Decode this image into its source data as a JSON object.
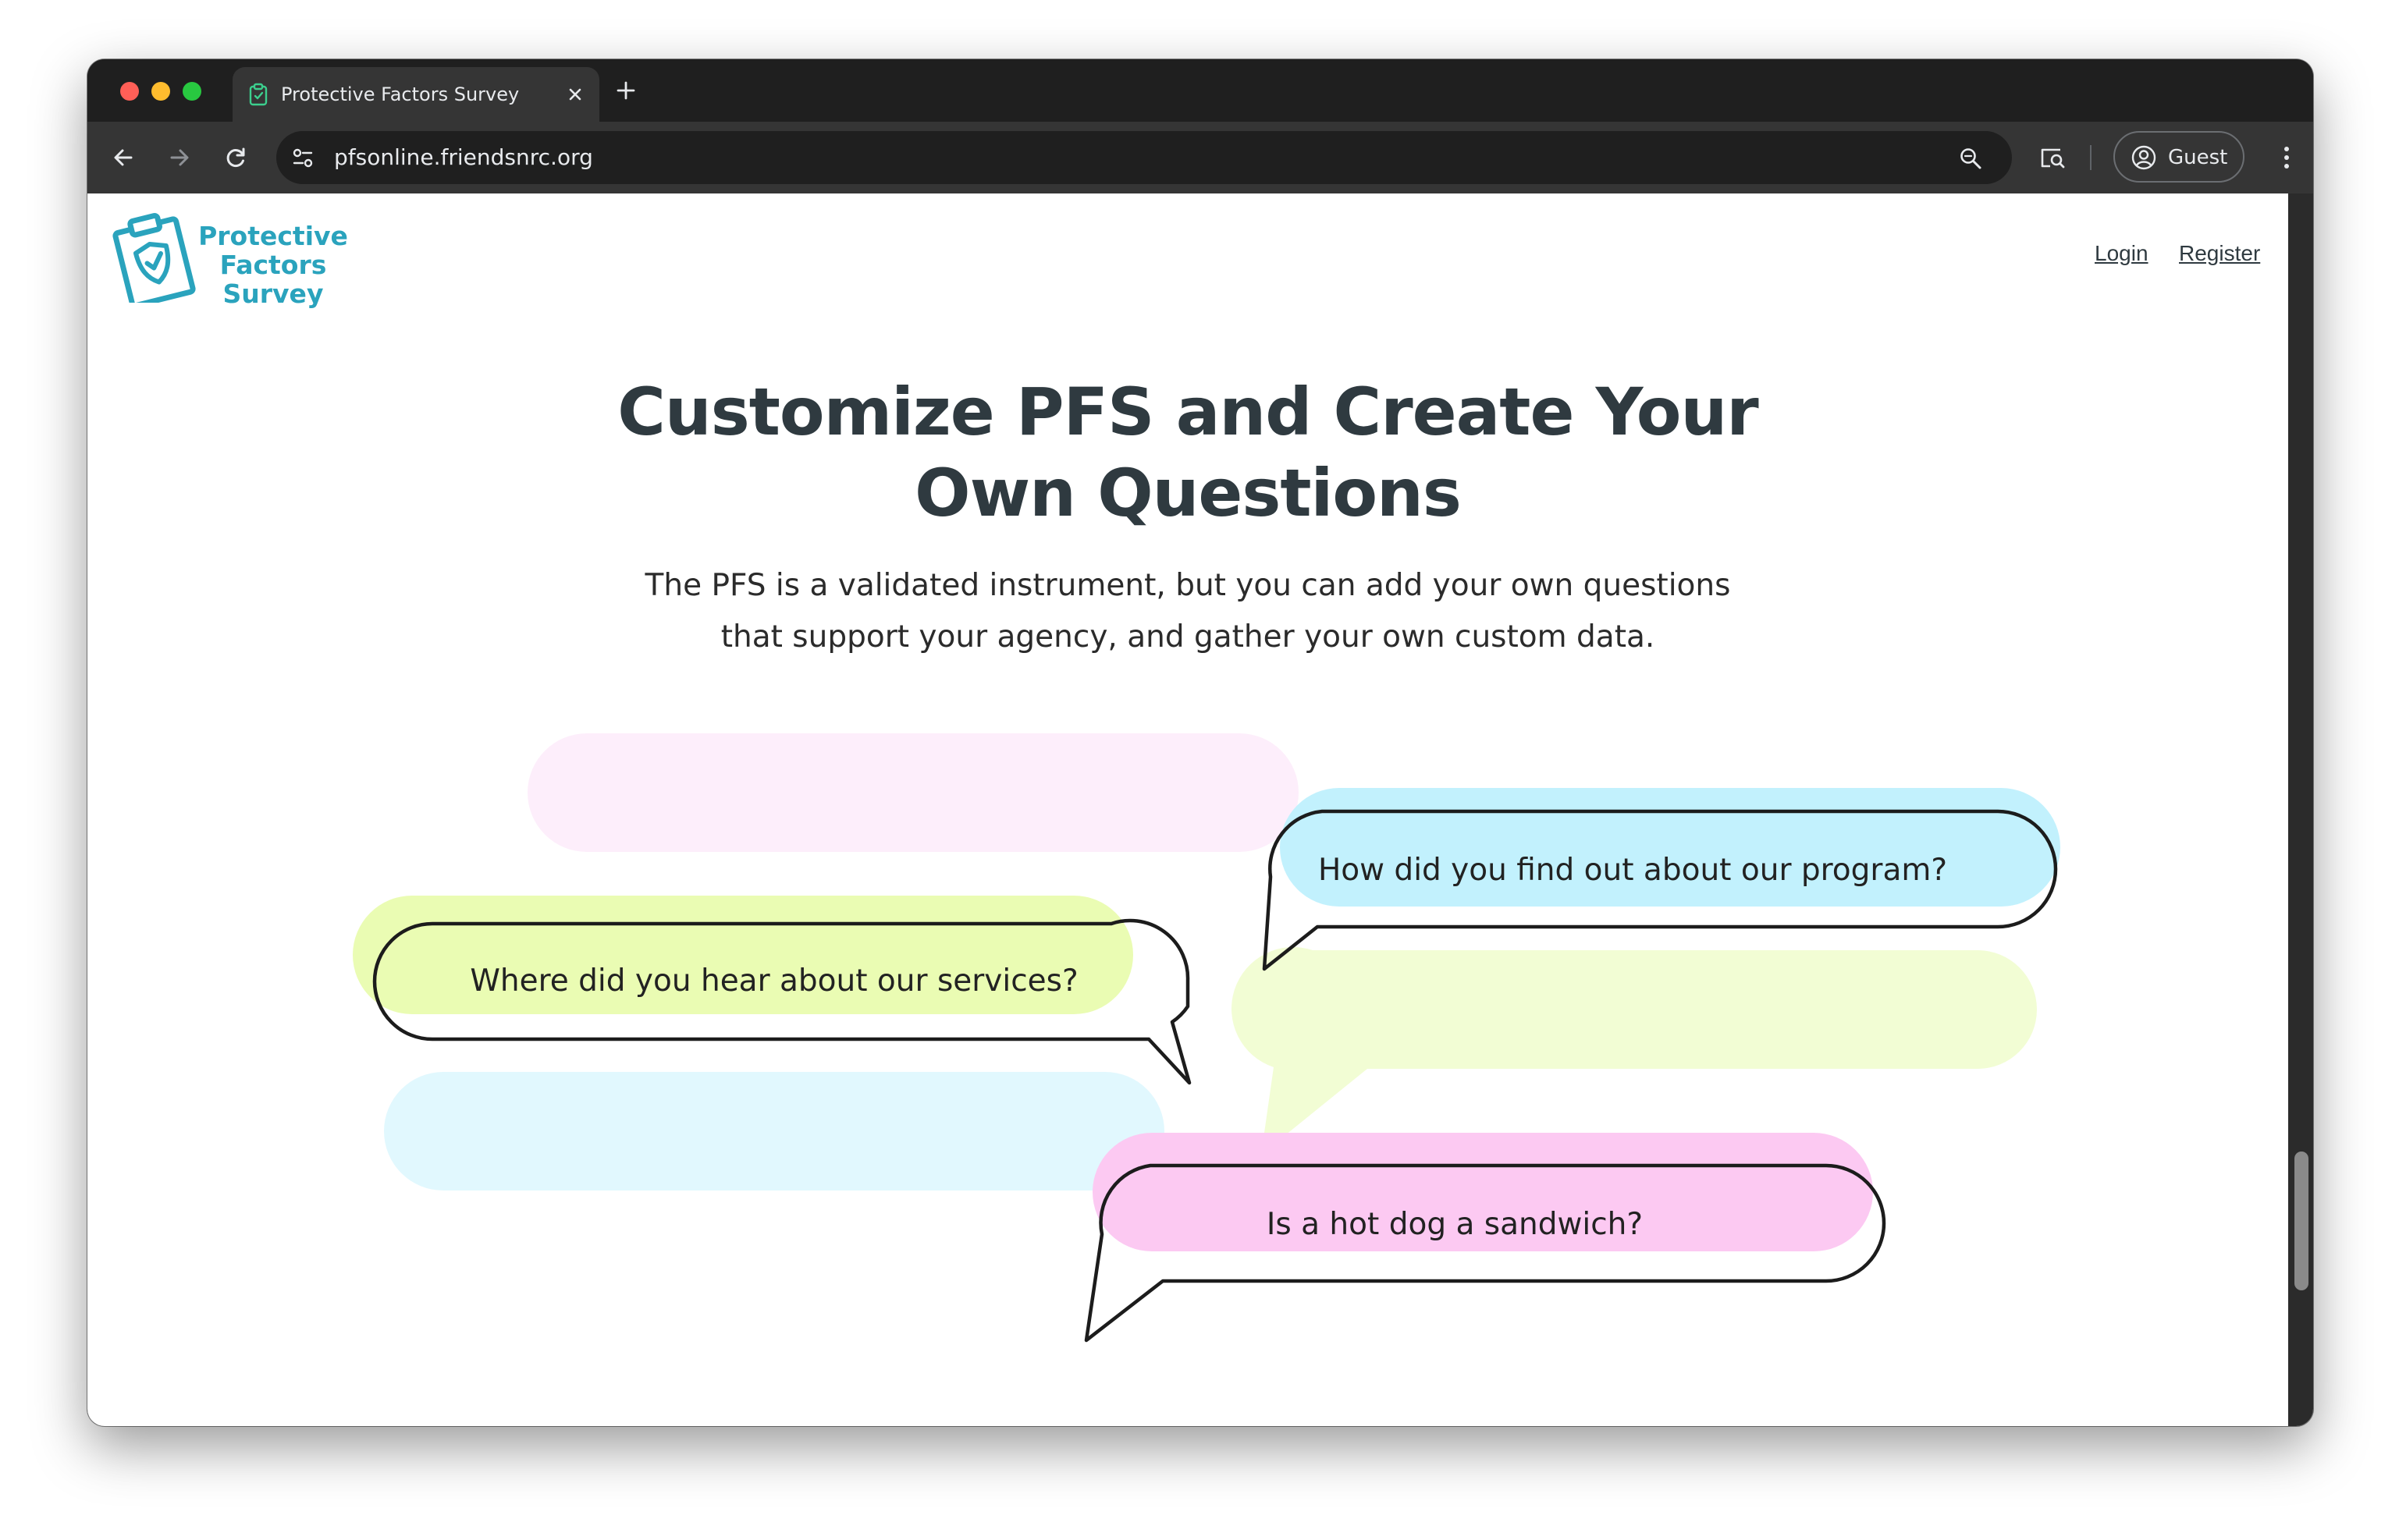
{
  "browser": {
    "tab_title": "Protective Factors Survey",
    "url": "pfsonline.friendsnrc.org",
    "profile_label": "Guest"
  },
  "header": {
    "logo_lines": [
      "Protective",
      "Factors",
      "Survey"
    ],
    "login_label": "Login",
    "register_label": "Register"
  },
  "hero": {
    "title_line1": "Customize PFS and Create Your",
    "title_line2": "Own Questions",
    "subtitle_line1": "The PFS is a validated instrument, but you can add your own questions",
    "subtitle_line2": "that support your agency, and gather your own custom data."
  },
  "bubbles": [
    "How did you find out about our program?",
    "Where did you hear about our services?",
    "Is a hot dog a sandwich?"
  ],
  "colors": {
    "brand_teal": "#2aa3bd",
    "heading_text": "#2f3a40",
    "bubble_pink_light": "#fdeefb",
    "bubble_cyan": "#c2f1fd",
    "bubble_lime": "#eafcb3",
    "bubble_lime_light": "#f2fdd4",
    "bubble_cyan_light": "#e1f8fe",
    "bubble_pink": "#fcc9f2"
  }
}
